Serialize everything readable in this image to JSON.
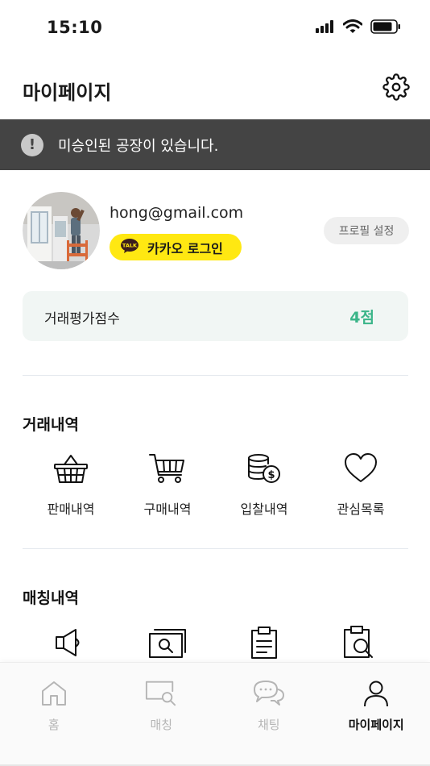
{
  "status_bar": {
    "time": "15:10"
  },
  "header": {
    "title": "마이페이지"
  },
  "notice": {
    "text": "미승인된 공장이 있습니다."
  },
  "profile": {
    "email": "hong@gmail.com",
    "kakao_badge": "TALK",
    "kakao_login_label": "카카오 로그인",
    "settings_label": "프로필 설정"
  },
  "score": {
    "label": "거래평가점수",
    "value": "4점"
  },
  "transactions": {
    "title": "거래내역",
    "items": [
      {
        "label": "판매내역",
        "icon": "basket-icon"
      },
      {
        "label": "구매내역",
        "icon": "cart-icon"
      },
      {
        "label": "입찰내역",
        "icon": "coins-icon"
      },
      {
        "label": "관심목록",
        "icon": "heart-icon"
      }
    ]
  },
  "matching": {
    "title": "매칭내역",
    "items": [
      {
        "icon": "megaphone-icon"
      },
      {
        "icon": "image-search-icon"
      },
      {
        "icon": "clipboard-icon"
      },
      {
        "icon": "clipboard-search-icon"
      }
    ]
  },
  "tabs": [
    {
      "label": "홈",
      "icon": "home-icon",
      "active": false
    },
    {
      "label": "매칭",
      "icon": "monitor-search-icon",
      "active": false
    },
    {
      "label": "채팅",
      "icon": "chat-icon",
      "active": false
    },
    {
      "label": "마이페이지",
      "icon": "user-icon",
      "active": true
    }
  ],
  "colors": {
    "notice_bg": "#444444",
    "kakao_yellow": "#ffe812",
    "score_green": "#3bb589",
    "score_card_bg": "#f1f6f4",
    "tab_inactive": "#b5b5b5"
  }
}
